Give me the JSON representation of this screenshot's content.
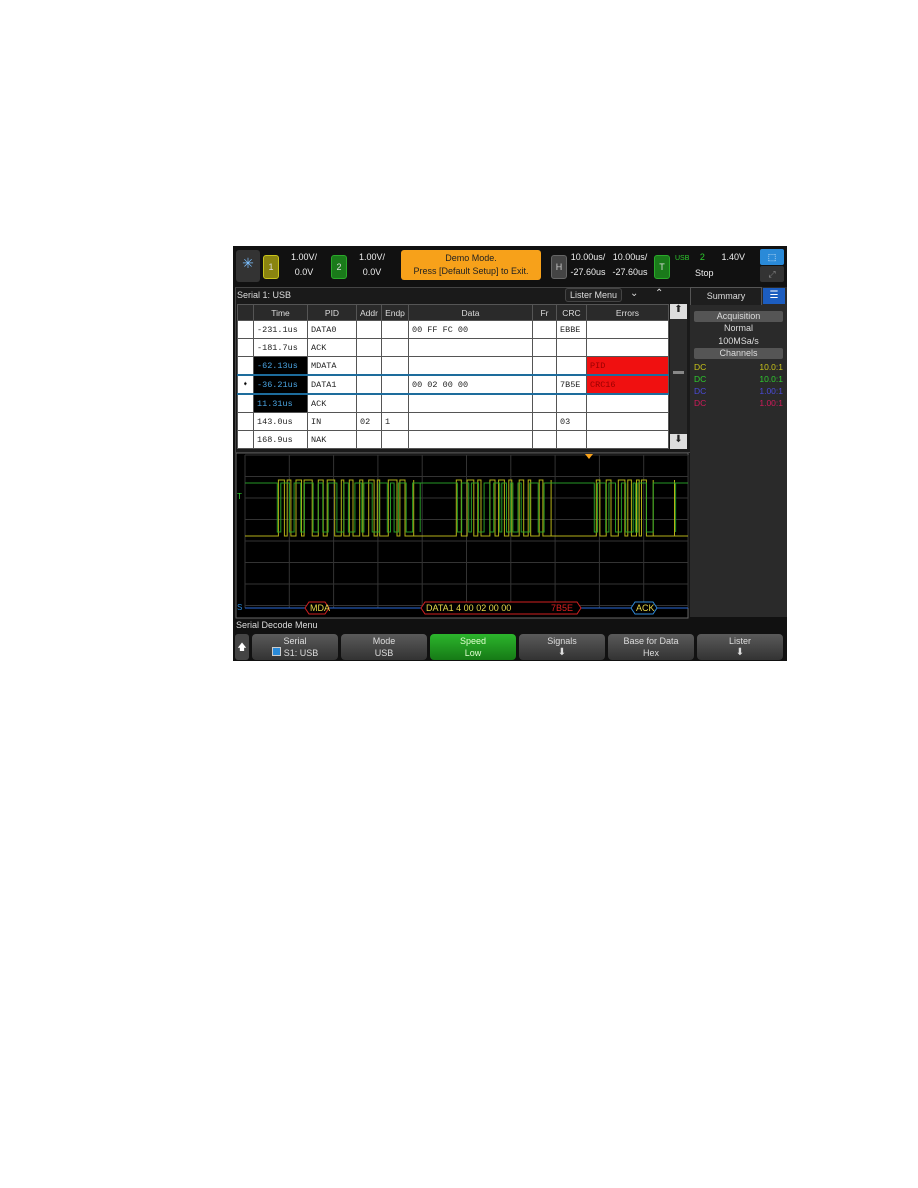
{
  "top_bar": {
    "ch1": {
      "label": "1",
      "scale": "1.00V/",
      "offset": "0.0V",
      "color": "#c9c41a"
    },
    "ch2": {
      "label": "2",
      "scale": "1.00V/",
      "offset": "0.0V",
      "color": "#2aaa2a"
    },
    "demo": {
      "line1": "Demo Mode.",
      "line2": "Press [Default Setup] to Exit."
    },
    "horizontal": {
      "label": "H",
      "scale1": "10.00us/",
      "scale2": "10.00us/",
      "delay1": "-27.60us",
      "delay2": "-27.60us"
    },
    "trigger": {
      "label": "T",
      "type": "USB",
      "source": "2",
      "level": "1.40V",
      "status": "Stop"
    }
  },
  "lister": {
    "title": "Serial 1: USB",
    "menu_label": "Lister Menu",
    "columns": [
      "Time",
      "PID",
      "Addr",
      "Endp",
      "Data",
      "Fr",
      "CRC",
      "Errors"
    ],
    "rows": [
      {
        "time": "-231.1us",
        "pid": "DATA0",
        "addr": "",
        "endp": "",
        "data": "00 FF FC 00",
        "fr": "",
        "crc": "EBBE",
        "errors": ""
      },
      {
        "time": "-181.7us",
        "pid": "ACK",
        "addr": "",
        "endp": "",
        "data": "",
        "fr": "",
        "crc": "",
        "errors": ""
      },
      {
        "time": "-62.13us",
        "pid": "MDATA",
        "addr": "",
        "endp": "",
        "data": "",
        "fr": "",
        "crc": "",
        "errors": "PID"
      },
      {
        "time": "-36.21us",
        "pid": "DATA1",
        "addr": "",
        "endp": "",
        "data": "00 02 00 00",
        "fr": "",
        "crc": "7B5E",
        "errors": "CRC16"
      },
      {
        "time": "11.31us",
        "pid": "ACK",
        "addr": "",
        "endp": "",
        "data": "",
        "fr": "",
        "crc": "",
        "errors": ""
      },
      {
        "time": "143.0us",
        "pid": "IN",
        "addr": "02",
        "endp": "1",
        "data": "",
        "fr": "",
        "crc": "03",
        "errors": ""
      },
      {
        "time": "168.9us",
        "pid": "NAK",
        "addr": "",
        "endp": "",
        "data": "",
        "fr": "",
        "crc": "",
        "errors": ""
      }
    ]
  },
  "summary": {
    "tab": "Summary",
    "acq_header": "Acquisition",
    "acq_mode": "Normal",
    "acq_rate": "100MSa/s",
    "chan_header": "Channels",
    "channels": [
      {
        "coupling": "DC",
        "probe": "10.0:1",
        "color": "#c9c41a"
      },
      {
        "coupling": "DC",
        "probe": "10.0:1",
        "color": "#2ecc2e"
      },
      {
        "coupling": "DC",
        "probe": "1.00:1",
        "color": "#4a4ad8"
      },
      {
        "coupling": "DC",
        "probe": "1.00:1",
        "color": "#d01a5a"
      }
    ]
  },
  "decode": {
    "label": "S",
    "packets": [
      {
        "text": "MDA",
        "color": "#d02020"
      },
      {
        "text": "DATA1 4 00 02 00 00",
        "crc": "7B5E",
        "color": "#d02020"
      },
      {
        "text": "ACK",
        "color": "#2f8ad8"
      }
    ]
  },
  "menu": {
    "title": "Serial Decode Menu",
    "softkeys": [
      {
        "label": "Serial",
        "value": "S1: USB"
      },
      {
        "label": "Mode",
        "value": "USB"
      },
      {
        "label": "Speed",
        "value": "Low"
      },
      {
        "label": "Signals",
        "value": ""
      },
      {
        "label": "Base for Data",
        "value": "Hex"
      },
      {
        "label": "Lister",
        "value": ""
      }
    ]
  }
}
